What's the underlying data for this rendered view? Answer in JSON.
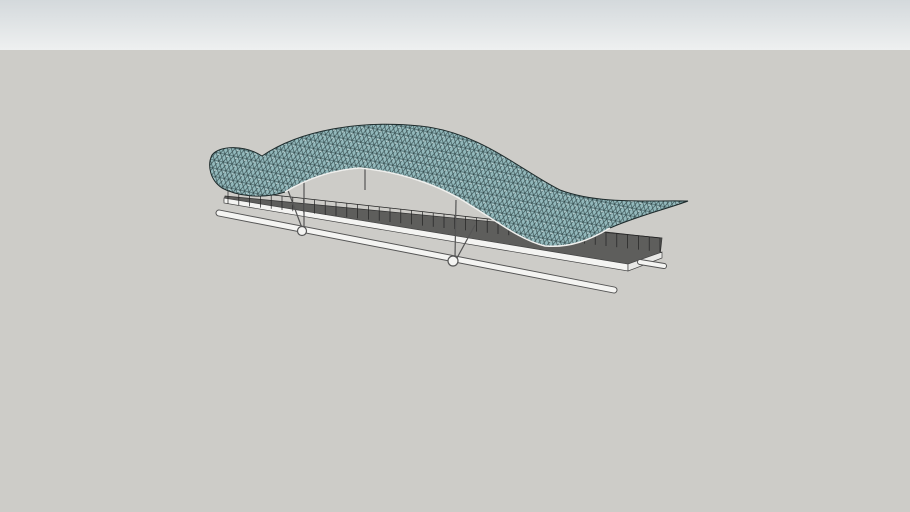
{
  "colors": {
    "toolbar_top": "#d4d9dc",
    "toolbar_bottom": "#eef0f0",
    "canvas": "#cdccc8",
    "canopy": "#8fb5b8",
    "deck": "#5e5e5c",
    "structure": "#f4f4f2"
  },
  "icons": {
    "model": "bridge-canopy-model"
  }
}
